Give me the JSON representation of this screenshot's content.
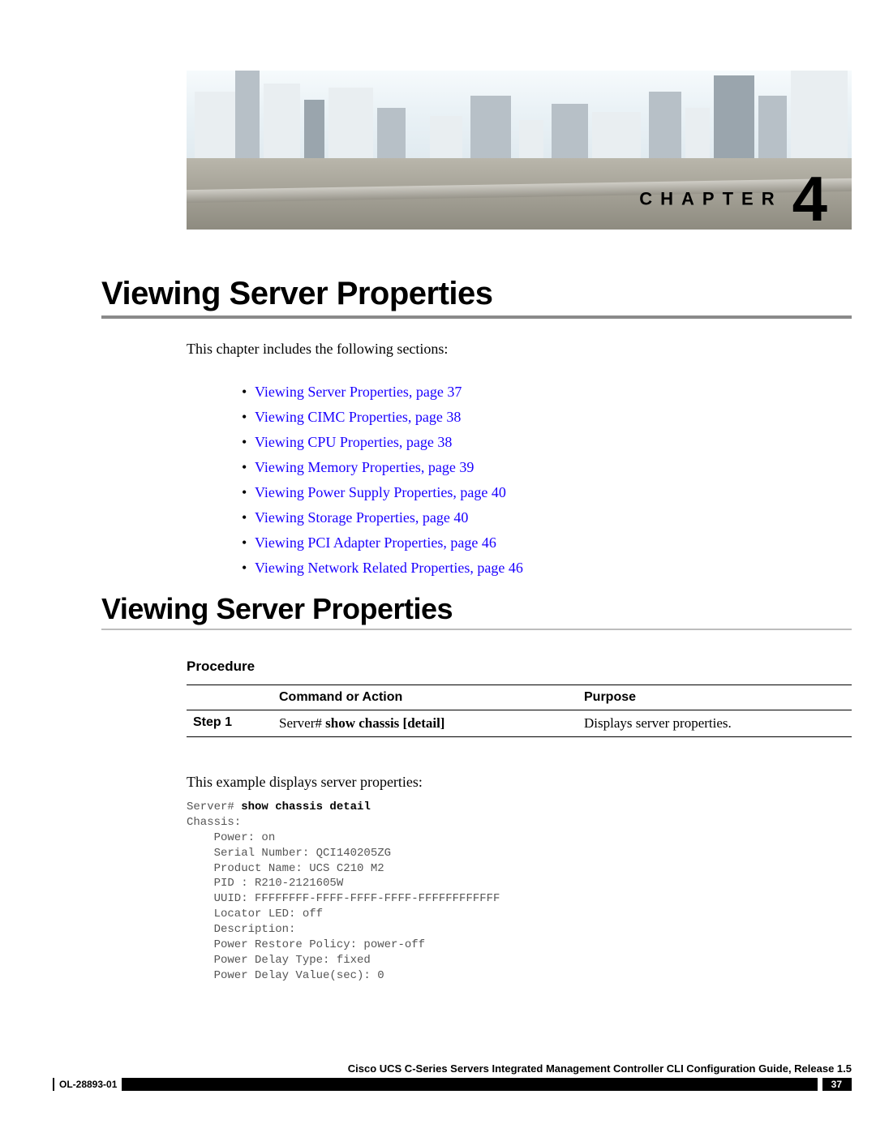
{
  "chapter": {
    "label": "CHAPTER",
    "number": "4"
  },
  "title": "Viewing Server Properties",
  "intro": "This chapter includes the following sections:",
  "toc": [
    "Viewing Server Properties,  page  37",
    "Viewing CIMC Properties,  page  38",
    "Viewing CPU Properties,  page  38",
    "Viewing Memory Properties,  page  39",
    "Viewing Power Supply Properties,  page  40",
    "Viewing Storage Properties,  page  40",
    "Viewing PCI Adapter Properties,  page  46",
    "Viewing Network Related Properties,  page  46"
  ],
  "section_heading": "Viewing Server Properties",
  "procedure_label": "Procedure",
  "table": {
    "headers": {
      "blank": "",
      "command": "Command or Action",
      "purpose": "Purpose"
    },
    "row": {
      "step": "Step 1",
      "prompt": "Server# ",
      "cmd": "show chassis [detail]",
      "purpose": "Displays server properties."
    }
  },
  "example_intro": "This example displays server properties:",
  "cli": {
    "prompt": "Server# ",
    "cmd": "show chassis detail",
    "lines": [
      "Chassis:",
      "    Power: on",
      "    Serial Number: QCI140205ZG",
      "    Product Name: UCS C210 M2",
      "    PID : R210-2121605W",
      "    UUID: FFFFFFFF-FFFF-FFFF-FFFF-FFFFFFFFFFFF",
      "    Locator LED: off",
      "    Description:",
      "    Power Restore Policy: power-off",
      "    Power Delay Type: fixed",
      "    Power Delay Value(sec): 0"
    ]
  },
  "footer": {
    "title": "Cisco UCS C-Series Servers Integrated Management Controller CLI Configuration Guide, Release 1.5",
    "doc_id": "OL-28893-01",
    "page": "37"
  }
}
